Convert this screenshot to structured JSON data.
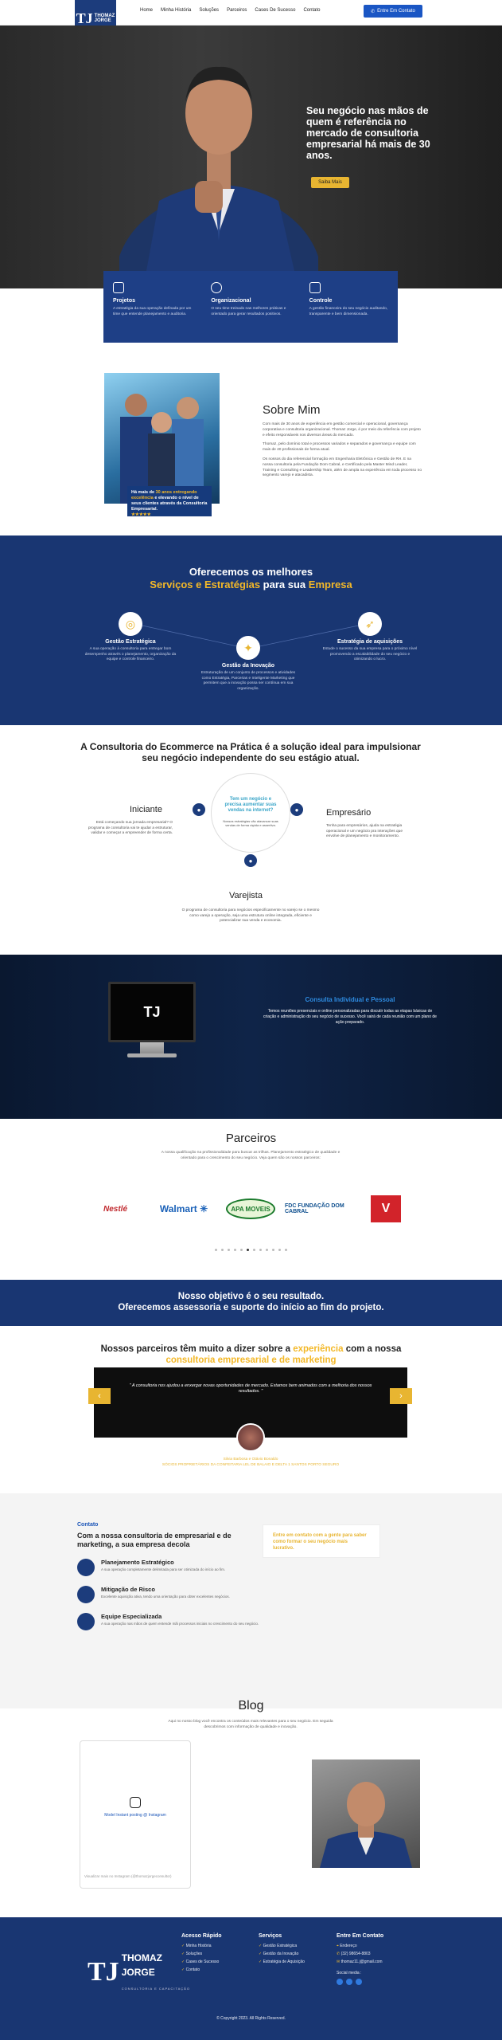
{
  "nav": {
    "logo_lines": [
      "THOMAZ",
      "JORGE"
    ],
    "links": [
      "Home",
      "Minha História",
      "Soluções",
      "Parceiros",
      "Cases De Sucesso",
      "Contato"
    ],
    "cta": "Entre Em Contato"
  },
  "hero": {
    "title": "Seu negócio nas mãos de quem é referência no mercado de consultoria empresarial há mais de 30 anos.",
    "button": "Saiba Mais"
  },
  "cards": [
    {
      "title": "Projetos",
      "text": "A estratégia da sua operação definada por um time que entende planejamento e auditoria.",
      "icon": "document-icon"
    },
    {
      "title": "Organizacional",
      "text": "O seu time treinado nas melhores práticas e orientado para gerar resultados positivos.",
      "icon": "team-icon"
    },
    {
      "title": "Controle",
      "text": "A gestão financeira do seu negócio auditando, transparente e bem dimensionada.",
      "icon": "chart-icon"
    }
  ],
  "sobre": {
    "caption_pre": "Há mais de",
    "caption_highlight": "30 anos entregando excelência",
    "caption_post": "e elevando o nível de seus clientes através da Consultoria Empresarial.",
    "stars": "★★★★★",
    "title": "Sobre Mim",
    "paragraphs": [
      "Com mais de 30 anos de experiência em gestão comercial e operacional, governança corporativa e consultoria organizacional. Thomaz Jorge, é por meio da referência com projeto e efeito responsáveis nos diversos áreas do mercado.",
      "Thomaz, pelo domínio total e processos variados e separados e governança e equipe com mais de 40 profissionais de forma atual.",
      "Os nossos do dia referencial formação em Engenharia Eletrônica e Gestão de RH. E na nossa consultoria pela Fundação Dom Cabral, e Certificado pela Master Mind Leader, Training e Consulting e Leadership Team, além de ampla na experiência em toda processo no segmento varejo e atacadista."
    ]
  },
  "services": {
    "title_pre": "Oferecemos os melhores",
    "title_highlight": "Serviços e Estratégias",
    "title_mid": "para sua",
    "title_highlight2": "Empresa",
    "items": [
      {
        "title": "Gestão Estratégica",
        "text": "A sua operação à consultoria para entregar bom desempenho através o planejamento, organização da equipe e controle financeiro.",
        "icon": "target-icon"
      },
      {
        "title": "Gestão da Inovação",
        "text": "Estruturação de um conjunto de processos e atividades como Estratégia, Parcerias e Inteligente Marketing que permitem que a inovação possa ser contínua em sua organização.",
        "icon": "lightbulb-icon"
      },
      {
        "title": "Estratégia de aquisições",
        "text": "Estude o sucesso da sua empresa para o próximo nível promovendo a escalabilidade do seu negócio e otimizando o lucro.",
        "icon": "rocket-icon"
      }
    ]
  },
  "consultoria": {
    "title": "A Consultoria do Ecommerce na Prática é a solução ideal para impulsionar seu negócio independente do seu estágio atual.",
    "center_title": "Tem um negócio e precisa aumentar suas vendas na internet?",
    "center_sub": "Nossos estratégias vão alavancar suas vendas de forma rápida e assertiva.",
    "stages": [
      {
        "name": "Iniciante",
        "text": "Está começando sua jornada empresarial? O programa de consultoria vai te ajudar a estruturar, validar e começar a empreender de forma certa."
      },
      {
        "name": "Empresário",
        "text": "Tenha para empresários, ajuda na estratégia operacional e um negócio pra interações que envolve de planejamento e monitoramento."
      },
      {
        "name": "Varejista",
        "text": "O programa de consultoria para negócios especificamente no varejo se o mesmo como varejo a operação, seja uma estrutura online integrada, eficiente e potencializar sua venda e economia."
      }
    ]
  },
  "consulta": {
    "monitor_text": "TJ",
    "title": "Consulta Individual e Pessoal",
    "text": "Temos reuniões presenciais e online personalizadas para discutir todas as etapas básicas de criação e administração do seu negócio de sucesso. Você sairá de cada reunião com um plano de ação preparado."
  },
  "parceiros": {
    "title": "Parceiros",
    "text": "A nossa qualificação na profissionalidade para buscar as trilhas. Planejamento estratégico de qualidade e orientado para o crescimento do seu negócio. Veja quem são os nossos parceiros:",
    "logos": [
      "Nestlé",
      "Walmart ✳",
      "APA MOVEIS",
      "FDC FUNDAÇÃO DOM CABRAL",
      "V"
    ]
  },
  "objetivo": {
    "line1": "Nosso objetivo é o seu resultado.",
    "line2": "Oferecemos assessoria e suporte do início ao fim do projeto."
  },
  "depoimentos": {
    "title_pre": "Nossos parceiros têm muito a dizer sobre a",
    "title_highlight": "experiência",
    "title_mid": "com a nossa",
    "title_highlight2": "consultoria empresarial e de marketing",
    "quote": "\" A consultoria nos ajudou a enxergar novas oportunidades de mercado. Estamos bem animados com a melhoria dos nossos resultados. \"",
    "name": "Silvia Barbosa e Otávio Bonaldo",
    "role": "SÓCIOS PROPRIETÁRIOS DA CONFEITARIA LEL DE BALAIO E DELTA 1 SANTOS PORTO SEGURO"
  },
  "contato": {
    "label": "Contato",
    "title": "Com a nossa consultoria de empresarial e de marketing, a sua empresa decola",
    "items": [
      {
        "title": "Planejamento Estratégico",
        "text": "A sua operação completamente delimitada para ser otimizada do início ao fim."
      },
      {
        "title": "Mitigação de Risco",
        "text": "Excelente aquisição ativa, tendo uma orientação para obter excelentes negócios."
      },
      {
        "title": "Equipe Especializada",
        "text": "A sua operação nas mãos de quem entende mãi processos iniciais no crescimento do seu negócio."
      }
    ],
    "box": "Entre em contato com a gente para saber como formar o seu negócio mais lucrativo."
  },
  "blog": {
    "title": "Blog",
    "text": "Aqui no nosso blog você encontra os conteúdos mais relevantes para o seu negócio. Em seguida descobrimos com informação de qualidade e inovação.",
    "insta_link": "Model Instant posting @ Instagram",
    "insta_foot": "Visualizar mais no Instagram (@thomazjorgeconsultor)"
  },
  "footer": {
    "logo_lines": [
      "THOMAZ",
      "JORGE"
    ],
    "logo_sub": "CONSULTORIA E CAPACITAÇÃO",
    "cols": [
      {
        "title": "Acesso Rápido",
        "items": [
          "Minha História",
          "Soluções",
          "Cases de Sucesso",
          "Contato"
        ]
      },
      {
        "title": "Serviços",
        "items": [
          "Gestão Estratégica",
          "Gestão da Inovação",
          "Estratégia de Aquisição"
        ]
      },
      {
        "title": "Entre Em Contato",
        "items": [
          "Endereço",
          "(32) 98654-8803",
          "thomaz11.j@gmail.com"
        ]
      }
    ],
    "social_label": "Social media :",
    "copyright": "© Copyright 2023. All Rights Reserved."
  }
}
